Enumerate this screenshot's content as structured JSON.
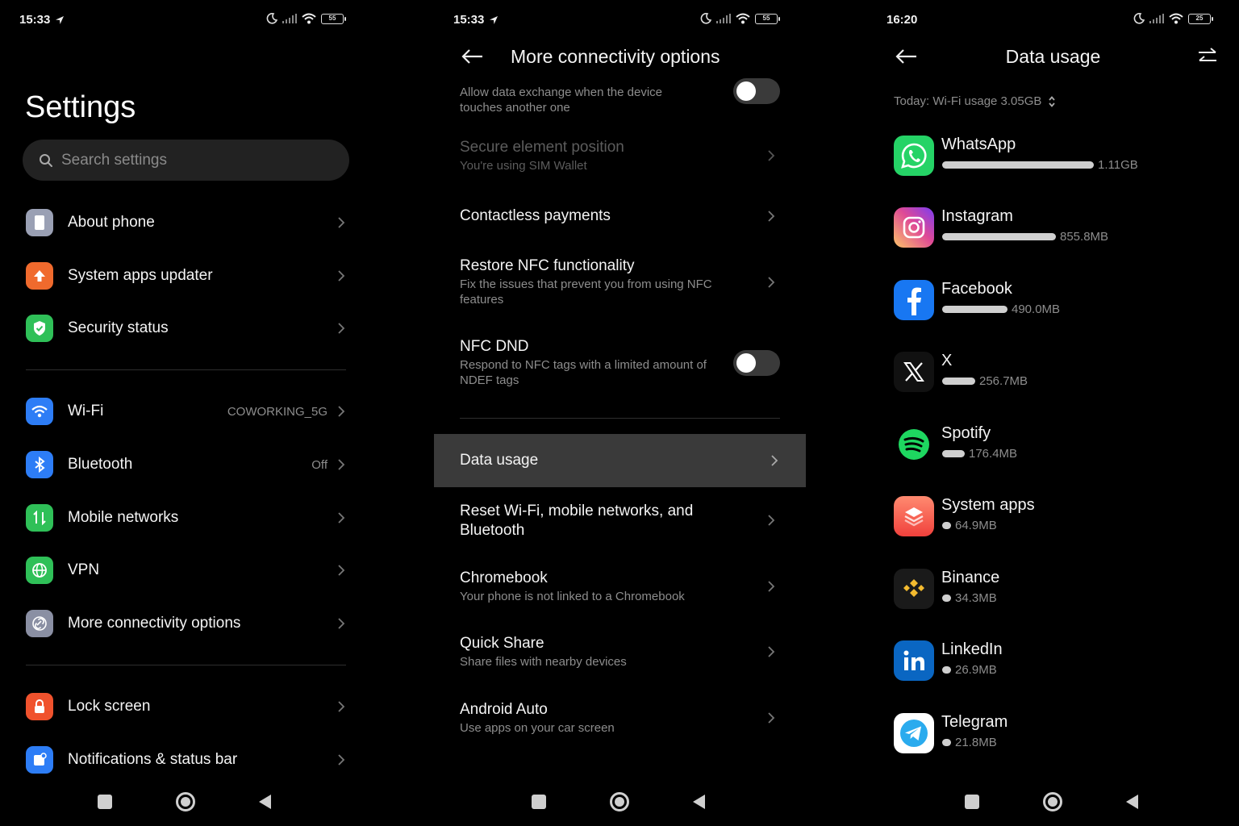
{
  "panel_settings": {
    "status": {
      "time": "15:33",
      "battery": "55"
    },
    "title": "Settings",
    "search": {
      "placeholder": "Search settings"
    },
    "group1": [
      {
        "label": "About phone",
        "icon": "phone-icon",
        "color": "#9aa0b4"
      },
      {
        "label": "System apps updater",
        "icon": "upload-arrow-icon",
        "color": "#f06a2d"
      },
      {
        "label": "Security status",
        "icon": "shield-check-icon",
        "color": "#2fc058"
      }
    ],
    "group2": [
      {
        "label": "Wi-Fi",
        "value": "COWORKING_5G",
        "icon": "wifi-icon",
        "color": "#2d7df6"
      },
      {
        "label": "Bluetooth",
        "value": "Off",
        "icon": "bluetooth-icon",
        "color": "#2d7df6"
      },
      {
        "label": "Mobile networks",
        "value": "",
        "icon": "mobile-data-icon",
        "color": "#2fc058"
      },
      {
        "label": "VPN",
        "value": "",
        "icon": "globe-icon",
        "color": "#2fc058"
      },
      {
        "label": "More connectivity options",
        "value": "",
        "icon": "link-icon",
        "color": "#8a8fa3"
      }
    ],
    "group3": [
      {
        "label": "Lock screen",
        "icon": "lock-icon",
        "color": "#f0522d"
      },
      {
        "label": "Notifications & status bar",
        "icon": "notification-icon",
        "color": "#2d7df6"
      }
    ]
  },
  "panel_connectivity": {
    "status": {
      "time": "15:33",
      "battery": "55"
    },
    "title": "More connectivity options",
    "items": [
      {
        "title": "",
        "subtitle": "Allow data exchange when the device touches another one",
        "type": "toggle",
        "on": false
      },
      {
        "title": "Secure element position",
        "subtitle": "You're using SIM  Wallet",
        "type": "link",
        "disabled": true
      },
      {
        "title": "Contactless payments",
        "subtitle": "",
        "type": "link"
      },
      {
        "title": "Restore NFC functionality",
        "subtitle": "Fix the issues that prevent you from using NFC features",
        "type": "link"
      },
      {
        "title": "NFC DND",
        "subtitle": "Respond to NFC tags with a limited amount of NDEF tags",
        "type": "toggle",
        "on": false
      },
      {
        "title": "Data usage",
        "subtitle": "",
        "type": "link",
        "highlighted": true
      },
      {
        "title": "Reset Wi-Fi, mobile networks, and Bluetooth",
        "subtitle": "",
        "type": "link"
      },
      {
        "title": "Chromebook",
        "subtitle": "Your phone is not linked to a Chromebook",
        "type": "link"
      },
      {
        "title": "Quick Share",
        "subtitle": "Share files with nearby devices",
        "type": "link"
      },
      {
        "title": "Android Auto",
        "subtitle": "Use apps on your car screen",
        "type": "link"
      }
    ]
  },
  "panel_data": {
    "status": {
      "time": "16:20",
      "battery": "25"
    },
    "title": "Data usage",
    "today": "Today: Wi-Fi usage 3.05GB",
    "apps": [
      {
        "name": "WhatsApp",
        "usage": "1.11GB",
        "share": 1.0,
        "icon": "whatsapp-icon",
        "color": "#25d366"
      },
      {
        "name": "Instagram",
        "usage": "855.8MB",
        "share": 0.75,
        "icon": "instagram-icon",
        "color": "#d6249f"
      },
      {
        "name": "Facebook",
        "usage": "490.0MB",
        "share": 0.43,
        "icon": "facebook-icon",
        "color": "#1877f2"
      },
      {
        "name": "X",
        "usage": "256.7MB",
        "share": 0.22,
        "icon": "x-icon",
        "color": "#111111"
      },
      {
        "name": "Spotify",
        "usage": "176.4MB",
        "share": 0.15,
        "icon": "spotify-icon",
        "color": "#1ed760"
      },
      {
        "name": "System apps",
        "usage": "64.9MB",
        "share": 0.06,
        "icon": "system-apps-icon",
        "color": "#f5665a"
      },
      {
        "name": "Binance",
        "usage": "34.3MB",
        "share": 0.06,
        "icon": "binance-icon",
        "color": "#f3ba2f"
      },
      {
        "name": "LinkedIn",
        "usage": "26.9MB",
        "share": 0.06,
        "icon": "linkedin-icon",
        "color": "#0a66c2"
      },
      {
        "name": "Telegram",
        "usage": "21.8MB",
        "share": 0.06,
        "icon": "telegram-icon",
        "color": "#2aabee"
      }
    ]
  }
}
